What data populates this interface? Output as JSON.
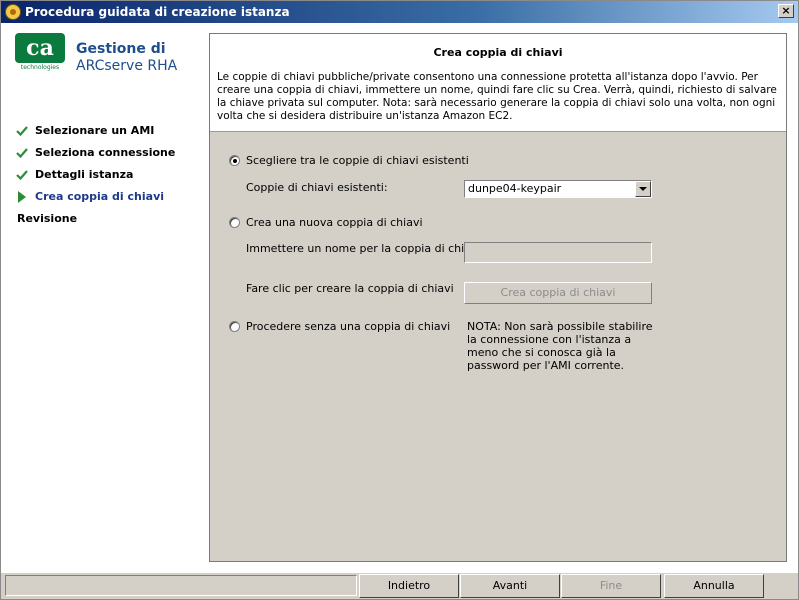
{
  "window": {
    "title": "Procedura guidata di creazione istanza",
    "close_label": "×"
  },
  "brand": {
    "logo_text": "ca",
    "logo_subtext": "technologies",
    "product_line1": "Gestione di",
    "product_line2": "ARCserve RHA"
  },
  "steps": [
    {
      "label": "Selezionare un AMI",
      "state": "done"
    },
    {
      "label": "Seleziona connessione",
      "state": "done"
    },
    {
      "label": "Dettagli istanza",
      "state": "done"
    },
    {
      "label": "Crea coppia di chiavi",
      "state": "current"
    },
    {
      "label": "Revisione",
      "state": "pending"
    }
  ],
  "header": {
    "title": "Crea coppia di chiavi",
    "description": "Le coppie di chiavi pubbliche/private consentono una connessione protetta all'istanza dopo l'avvio. Per creare una coppia di chiavi, immettere un nome, quindi fare clic su Crea. Verrà, quindi, richiesto di salvare la chiave privata sul computer. Nota: sarà necessario generare la coppia di chiavi solo una volta, non ogni volta che si desidera distribuire un'istanza Amazon EC2."
  },
  "options": {
    "existing": {
      "label": "Scegliere tra le coppie di chiavi esistenti",
      "selected": true
    },
    "existing_list_label": "Coppie di chiavi esistenti:",
    "existing_list_value": "dunpe04-keypair",
    "new": {
      "label": "Crea una nuova coppia di chiavi",
      "selected": false
    },
    "new_name_label": "Immettere un nome per la coppia di chiavi:",
    "new_name_value": "",
    "create_hint": "Fare clic per creare la coppia di chiavi",
    "create_button": "Crea coppia di chiavi",
    "none": {
      "label": "Procedere senza una coppia di chiavi",
      "selected": false
    },
    "note": "NOTA: Non sarà possibile stabilire la connessione con l'istanza a meno che si conosca già la password per l'AMI corrente."
  },
  "footer": {
    "back": {
      "label": "Indietro",
      "enabled": true
    },
    "next": {
      "label": "Avanti",
      "enabled": true
    },
    "finish": {
      "label": "Fine",
      "enabled": false
    },
    "cancel": {
      "label": "Annulla",
      "enabled": true
    }
  }
}
